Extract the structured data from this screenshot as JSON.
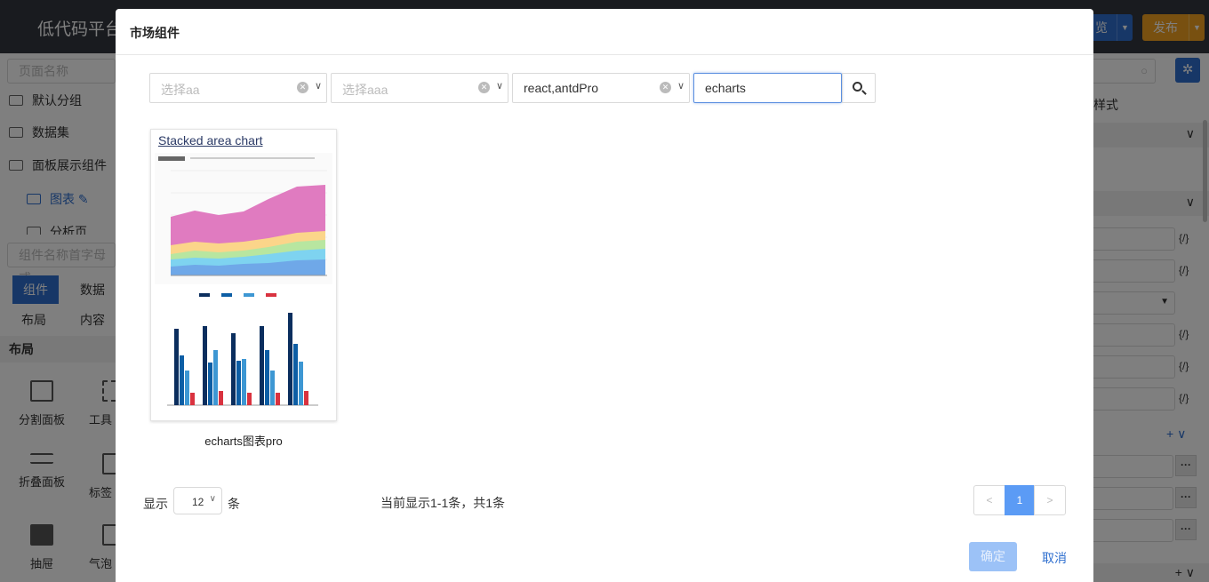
{
  "app": {
    "title": "低代码平台",
    "preview_label": "览",
    "publish_label": "发布"
  },
  "left_panel": {
    "page_search_placeholder": "页面名称",
    "tree": [
      {
        "label": "默认分组"
      },
      {
        "label": "数据集"
      },
      {
        "label": "面板展示组件"
      },
      {
        "label": "图表"
      },
      {
        "label": "分析页"
      }
    ],
    "component_search_placeholder": "组件名称首字母或",
    "tabs": [
      "组件",
      "数据"
    ],
    "sub_tabs": [
      "布局",
      "内容"
    ],
    "section_title": "布局",
    "widgets": [
      "分割面板",
      "工具",
      "折叠面板",
      "标签",
      "抽屉",
      "气泡"
    ]
  },
  "right_panel": {
    "style_label": "样式",
    "code_label": "{/}"
  },
  "modal": {
    "title": "市场组件",
    "filters": [
      {
        "value": "",
        "placeholder": "选择aa"
      },
      {
        "value": "",
        "placeholder": "选择aaa"
      },
      {
        "value": "react,antdPro",
        "placeholder": ""
      }
    ],
    "keyword": "echarts",
    "cards": [
      {
        "title": "Stacked area chart",
        "caption": "echarts图表pro"
      }
    ],
    "page_size_label": "显示",
    "page_size": "12",
    "page_size_unit": "条",
    "summary": "当前显示1-1条，共1条",
    "pager": {
      "prev": "<",
      "current": "1",
      "next": ">"
    },
    "ok_label": "确定",
    "cancel_label": "取消"
  },
  "colors": {
    "primary": "#2f6fcf",
    "publish": "#f0a020",
    "topbar": "#32373e"
  }
}
